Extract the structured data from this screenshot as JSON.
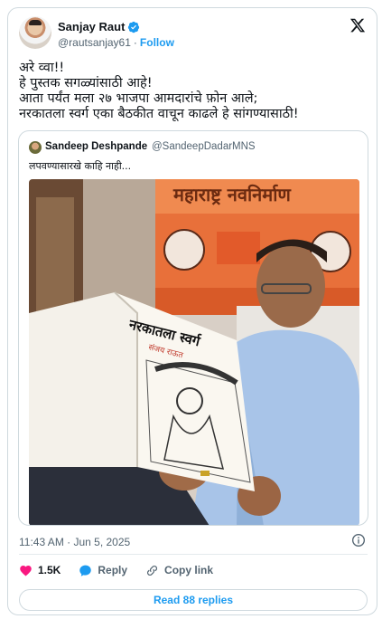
{
  "author": {
    "display_name": "Sanjay Raut",
    "handle": "@rautsanjay61",
    "follow_sep": "·",
    "follow_label": "Follow",
    "verified": true
  },
  "tweet": {
    "lines": [
      "अरे व्वा!!",
      "हे पुस्तक सगळ्यांसाठी आहे!",
      "आता पर्यंत मला २७ भाजपा आमदारांचे फ़ोन आले;",
      "नरकातला स्वर्ग एका बैठकीत वाचून काढले हे सांगण्यासाठी!"
    ]
  },
  "quoted": {
    "display_name": "Sandeep Deshpande",
    "handle": "@SandeepDadarMNS",
    "text": "लपवण्यासारखे काहि नाही...",
    "image": {
      "banner_text": "महाराष्ट्र नवनिर्माण",
      "book_title": "नरकातला स्वर्ग",
      "book_author": "संजय राऊत"
    }
  },
  "timestamp": "11:43 AM · Jun 5, 2025",
  "actions": {
    "likes": "1.5K",
    "reply_label": "Reply",
    "copy_label": "Copy link"
  },
  "read_replies_label": "Read 88 replies",
  "colors": {
    "accent": "#1d9bf0",
    "like": "#f91880",
    "text_secondary": "#536471",
    "border": "#cfd9de"
  },
  "icons": [
    "verified-badge-icon",
    "x-logo-icon",
    "info-icon",
    "heart-icon",
    "reply-icon",
    "link-icon"
  ]
}
